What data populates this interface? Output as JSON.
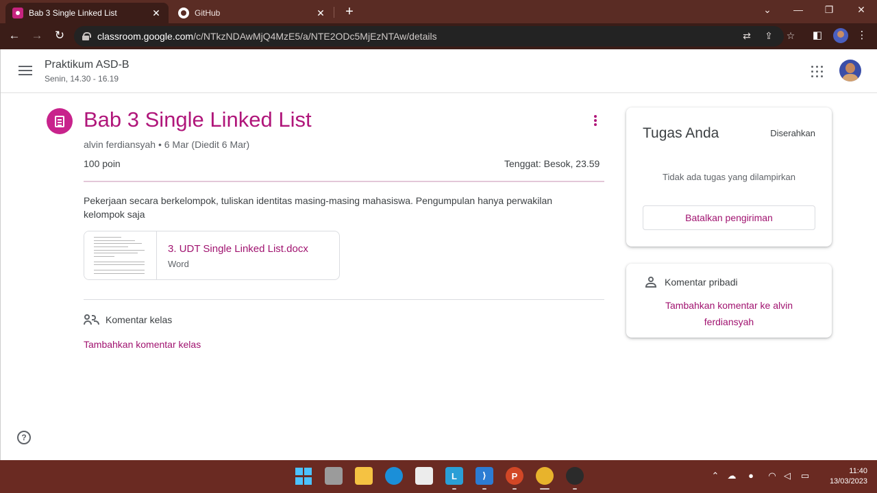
{
  "browser": {
    "tabs": [
      {
        "title": "Bab 3 Single Linked List",
        "close": "✕"
      },
      {
        "title": "GitHub",
        "close": "✕"
      }
    ],
    "new_tab": "+",
    "url_host": "classroom.google.com",
    "url_path": "/c/NTkzNDAwMjQ4MzE5/a/NTE2ODc5MjEzNTAw/details",
    "window_controls": [
      "⌄",
      "—",
      "❐",
      "✕"
    ]
  },
  "header": {
    "class_name": "Praktikum ASD-B",
    "class_schedule": "Senin, 14.30 - 16.19"
  },
  "assignment": {
    "title": "Bab 3 Single Linked List",
    "meta": "alvin ferdiansyah • 6 Mar (Diedit 6 Mar)",
    "points": "100 poin",
    "due": "Tenggat: Besok, 23.59",
    "description": "Pekerjaan secara berkelompok, tuliskan identitas masing-masing mahasiswa. Pengumpulan hanya perwakilan kelompok saja",
    "attachment": {
      "name": "3. UDT Single Linked List.docx",
      "type": "Word"
    },
    "class_comments_label": "Komentar kelas",
    "add_class_comment": "Tambahkan komentar kelas"
  },
  "your_work": {
    "title": "Tugas Anda",
    "status": "Diserahkan",
    "empty": "Tidak ada tugas yang dilampirkan",
    "unsubmit": "Batalkan pengiriman"
  },
  "private_comments": {
    "title": "Komentar pribadi",
    "add": "Tambahkan komentar ke alvin ferdiansyah"
  },
  "help": "?",
  "taskbar": {
    "time": "11:40",
    "date": "13/03/2023"
  },
  "colors": {
    "accent": "#b0167a",
    "chrome": "#5a2c24",
    "taskbar": "#6a2a22"
  }
}
